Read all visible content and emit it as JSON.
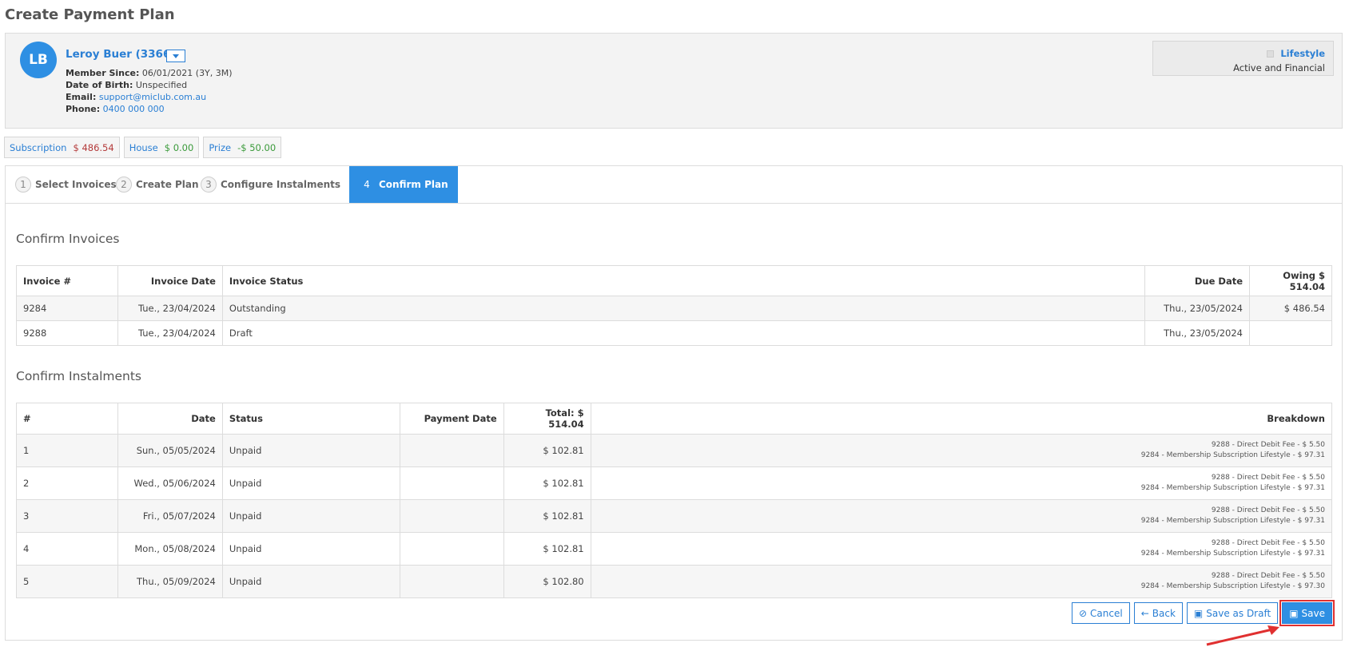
{
  "page_title": "Create Payment Plan",
  "member": {
    "initials": "LB",
    "name": "Leroy Buer (3366)",
    "member_since_label": "Member Since:",
    "member_since": "06/01/2021 (3Y, 3M)",
    "dob_label": "Date of Birth:",
    "dob": "Unspecified",
    "email_label": "Email:",
    "email": "support@miclub.com.au",
    "phone_label": "Phone:",
    "phone": "0400 000 000",
    "membership_type": "Lifestyle",
    "status": "Active and Financial"
  },
  "balances": [
    {
      "label": "Subscription",
      "value": "$ 486.54",
      "color": "#b43a3a"
    },
    {
      "label": "House",
      "value": "$ 0.00",
      "color": "#3a9a3a"
    },
    {
      "label": "Prize",
      "value": "-$ 50.00",
      "color": "#3a9a3a"
    }
  ],
  "tabs": [
    {
      "num": "1",
      "label": "Select Invoices"
    },
    {
      "num": "2",
      "label": "Create Plan"
    },
    {
      "num": "3",
      "label": "Configure Instalments"
    },
    {
      "num": "4",
      "label": "Confirm Plan"
    }
  ],
  "active_tab": 3,
  "invoices": {
    "title": "Confirm Invoices",
    "headers": [
      "Invoice #",
      "Invoice Date",
      "Invoice Status",
      "Due Date",
      "Owing $ 514.04"
    ],
    "rows": [
      {
        "invoice": "9284",
        "date": "Tue., 23/04/2024",
        "status": "Outstanding",
        "due": "Thu., 23/05/2024",
        "owing": "$ 486.54"
      },
      {
        "invoice": "9288",
        "date": "Tue., 23/04/2024",
        "status": "Draft",
        "due": "Thu., 23/05/2024",
        "owing": ""
      }
    ]
  },
  "instalments": {
    "title": "Confirm Instalments",
    "headers": [
      "#",
      "Date",
      "Status",
      "Payment Date",
      "Total: $ 514.04",
      "Breakdown"
    ],
    "rows": [
      {
        "num": "1",
        "date": "Sun., 05/05/2024",
        "status": "Unpaid",
        "payment_date": "",
        "total": "$ 102.81",
        "breakdown": [
          "9288 - Direct Debit Fee - $ 5.50",
          "9284 - Membership Subscription Lifestyle - $ 97.31"
        ]
      },
      {
        "num": "2",
        "date": "Wed., 05/06/2024",
        "status": "Unpaid",
        "payment_date": "",
        "total": "$ 102.81",
        "breakdown": [
          "9288 - Direct Debit Fee - $ 5.50",
          "9284 - Membership Subscription Lifestyle - $ 97.31"
        ]
      },
      {
        "num": "3",
        "date": "Fri., 05/07/2024",
        "status": "Unpaid",
        "payment_date": "",
        "total": "$ 102.81",
        "breakdown": [
          "9288 - Direct Debit Fee - $ 5.50",
          "9284 - Membership Subscription Lifestyle - $ 97.31"
        ]
      },
      {
        "num": "4",
        "date": "Mon., 05/08/2024",
        "status": "Unpaid",
        "payment_date": "",
        "total": "$ 102.81",
        "breakdown": [
          "9288 - Direct Debit Fee - $ 5.50",
          "9284 - Membership Subscription Lifestyle - $ 97.31"
        ]
      },
      {
        "num": "5",
        "date": "Thu., 05/09/2024",
        "status": "Unpaid",
        "payment_date": "",
        "total": "$ 102.80",
        "breakdown": [
          "9288 - Direct Debit Fee - $ 5.50",
          "9284 - Membership Subscription Lifestyle - $ 97.30"
        ]
      }
    ]
  },
  "actions": {
    "cancel": "Cancel",
    "back": "Back",
    "save_draft": "Save as Draft",
    "save": "Save"
  },
  "colors": {
    "accent": "#2e8fe3",
    "link": "#2a7fd4",
    "highlight": "#e03030"
  }
}
